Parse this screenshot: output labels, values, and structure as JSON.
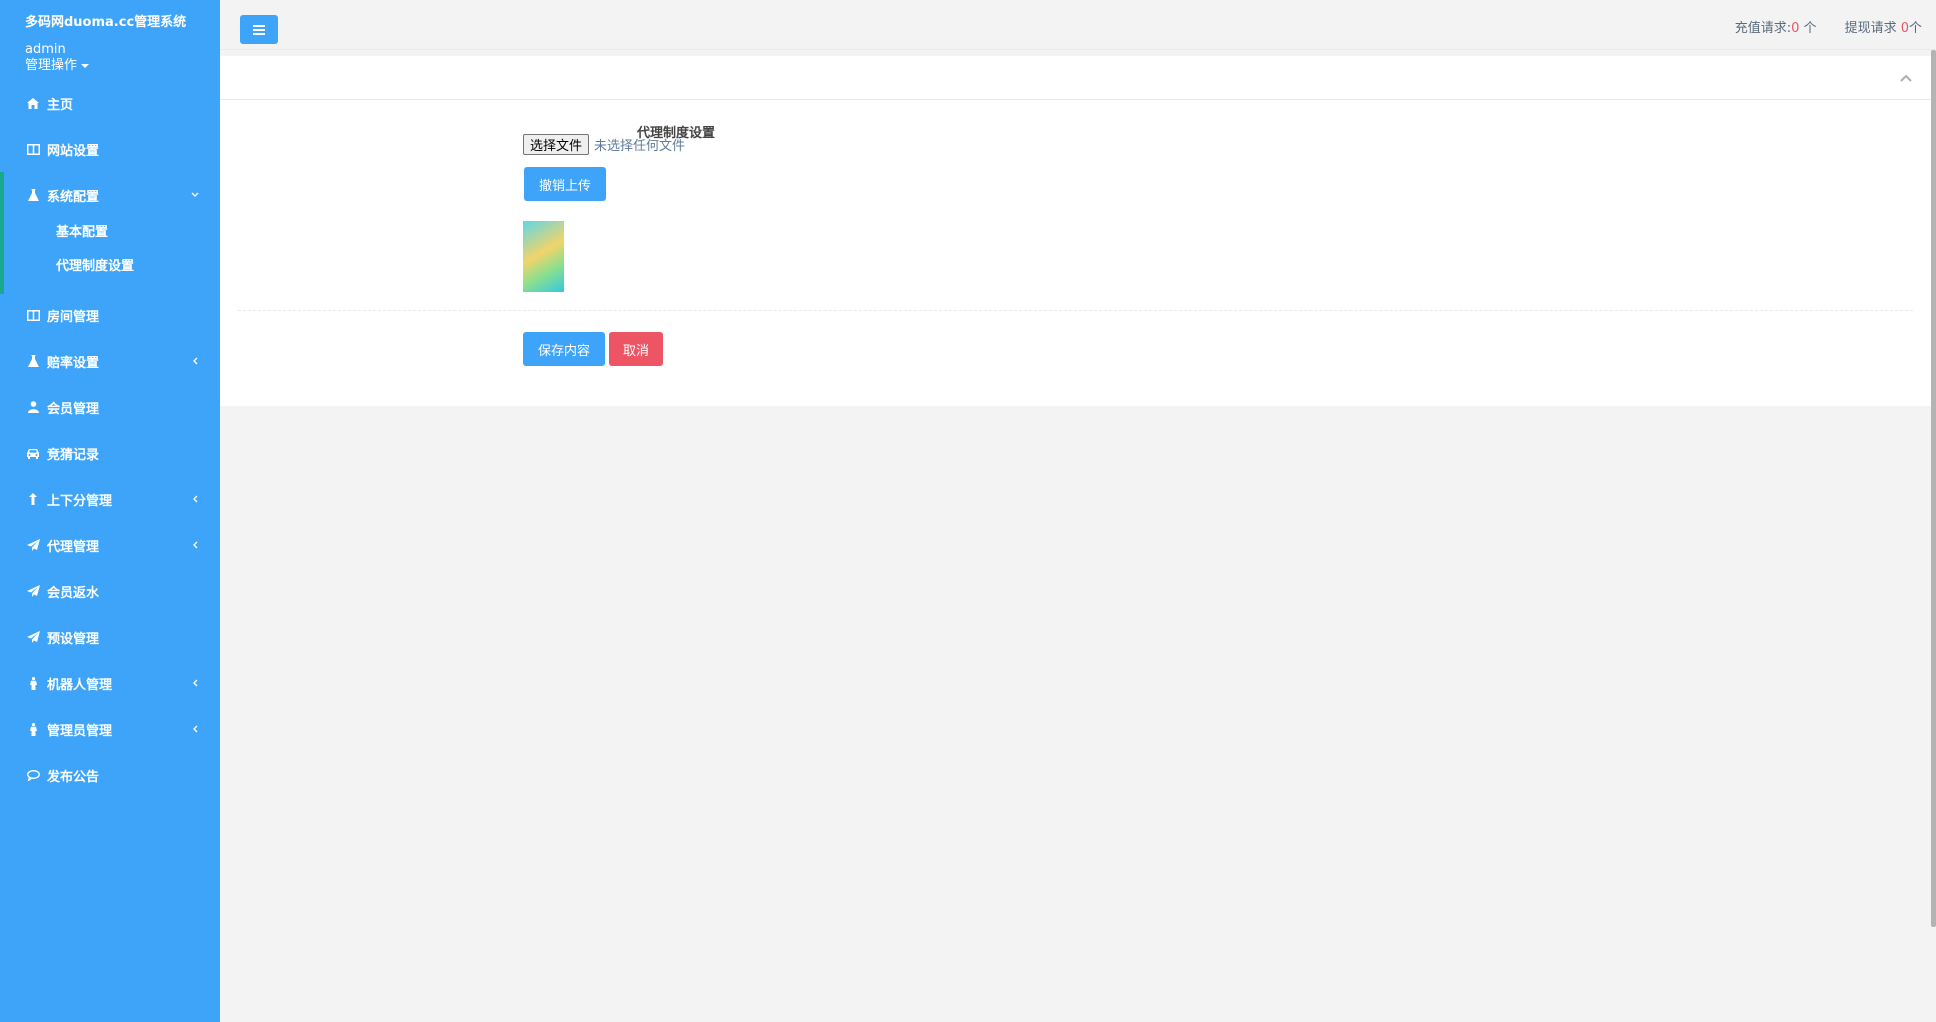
{
  "sidebar": {
    "site_title": "多码网duoma.cc管理系统",
    "username": "admin",
    "ops_label": "管理操作",
    "items": [
      {
        "label": "主页",
        "icon": "home-icon"
      },
      {
        "label": "网站设置",
        "icon": "columns-icon"
      },
      {
        "label": "系统配置",
        "icon": "flask-icon",
        "expanded": true,
        "children": [
          {
            "label": "基本配置"
          },
          {
            "label": "代理制度设置"
          }
        ]
      },
      {
        "label": "房间管理",
        "icon": "columns-icon"
      },
      {
        "label": "赔率设置",
        "icon": "flask-icon",
        "has_arrow": true
      },
      {
        "label": "会员管理",
        "icon": "user-icon"
      },
      {
        "label": "竞猜记录",
        "icon": "car-icon"
      },
      {
        "label": "上下分管理",
        "icon": "arrow-up-icon",
        "has_arrow": true
      },
      {
        "label": "代理管理",
        "icon": "paper-plane-icon",
        "has_arrow": true
      },
      {
        "label": "会员返水",
        "icon": "paper-plane-icon"
      },
      {
        "label": "预设管理",
        "icon": "paper-plane-icon"
      },
      {
        "label": "机器人管理",
        "icon": "male-icon",
        "has_arrow": true
      },
      {
        "label": "管理员管理",
        "icon": "male-icon",
        "has_arrow": true
      },
      {
        "label": "发布公告",
        "icon": "comment-icon"
      }
    ]
  },
  "topbar": {
    "recharge_label": "充值请求:",
    "recharge_count": "0",
    "recharge_unit": " 个",
    "withdraw_label": "提现请求 ",
    "withdraw_count": "0",
    "withdraw_unit": "个"
  },
  "form": {
    "field_label": "代理制度设置",
    "file_button": "选择文件",
    "file_status": "未选择任何文件",
    "cancel_upload": "撤销上传",
    "save": "保存内容",
    "cancel": "取消"
  },
  "colors": {
    "sidebar_bg": "#3ea4fa",
    "active_border": "#19aa8d",
    "danger": "#ed5565"
  }
}
